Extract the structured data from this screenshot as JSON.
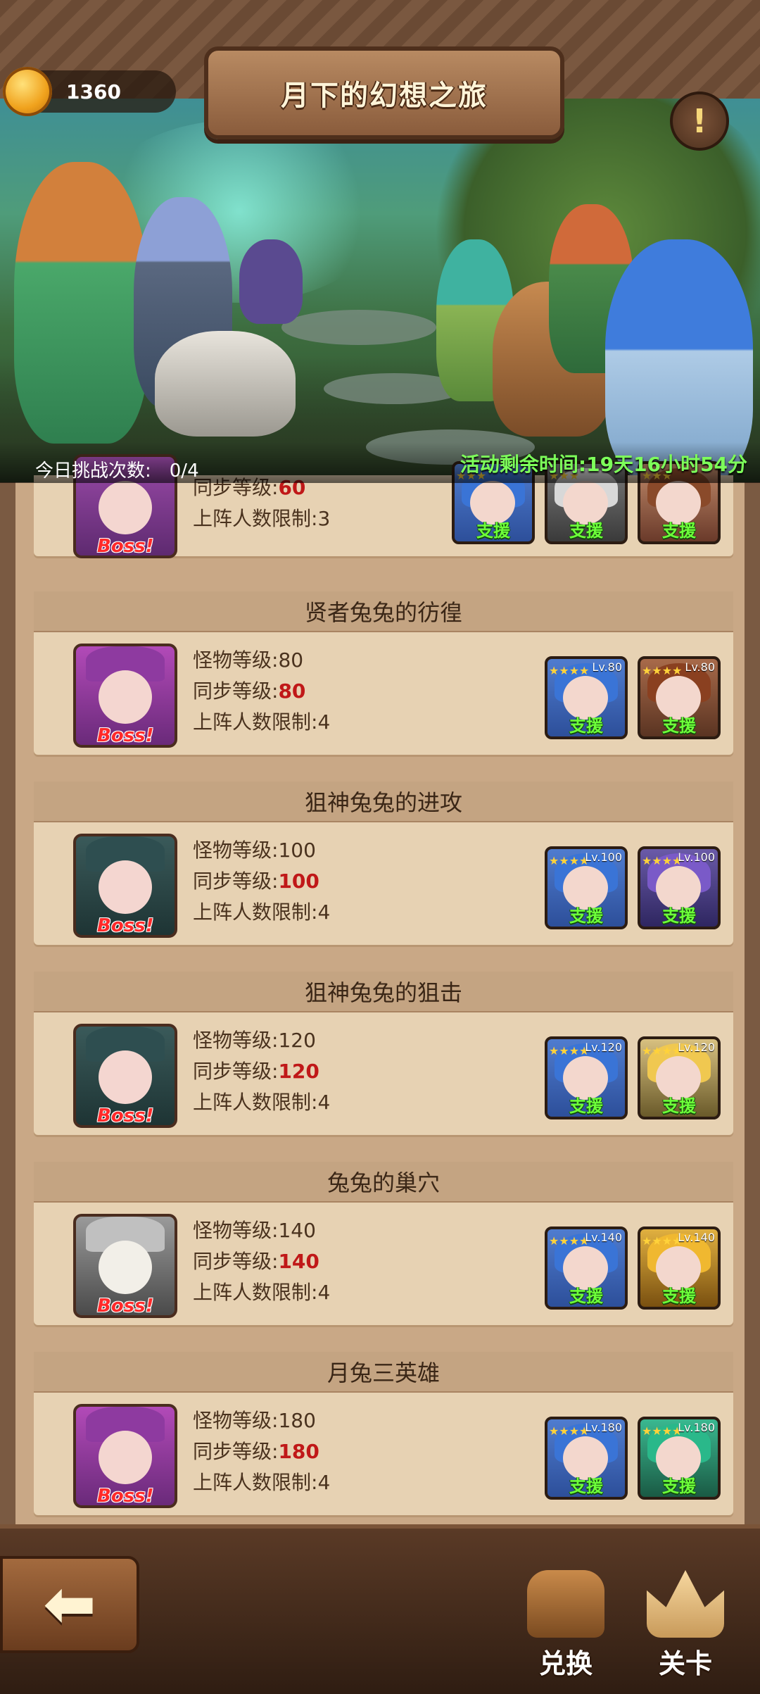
{
  "header": {
    "title": "月下的幻想之旅",
    "currency": "1360",
    "alert_icon": "!"
  },
  "banner": {
    "tries_label": "今日挑战次数:",
    "tries_value": "0/4",
    "remaining": "活动剩余时间:19天16小时54分"
  },
  "labels": {
    "monster_level": "怪物等级:",
    "sync_level": "同步等级:",
    "party_limit": "上阵人数限制:",
    "boss": "Boss!",
    "support": "支援"
  },
  "stages": [
    {
      "title": "",
      "monster_level": "",
      "sync_level": "60",
      "party_limit": "3",
      "allies": [
        {
          "lv": ""
        },
        {
          "lv": ""
        },
        {
          "lv": ""
        }
      ]
    },
    {
      "title": "贤者兔兔的彷徨",
      "monster_level": "80",
      "sync_level": "80",
      "party_limit": "4",
      "allies": [
        {
          "lv": "Lv.80"
        },
        {
          "lv": "Lv.80"
        }
      ]
    },
    {
      "title": "狙神兔兔的进攻",
      "monster_level": "100",
      "sync_level": "100",
      "party_limit": "4",
      "allies": [
        {
          "lv": "Lv.100"
        },
        {
          "lv": "Lv.100"
        }
      ]
    },
    {
      "title": "狙神兔兔的狙击",
      "monster_level": "120",
      "sync_level": "120",
      "party_limit": "4",
      "allies": [
        {
          "lv": "Lv.120"
        },
        {
          "lv": "Lv.120"
        }
      ]
    },
    {
      "title": "兔兔的巢穴",
      "monster_level": "140",
      "sync_level": "140",
      "party_limit": "4",
      "allies": [
        {
          "lv": "Lv.140"
        },
        {
          "lv": "Lv.140"
        }
      ]
    },
    {
      "title": "月兔三英雄",
      "monster_level": "180",
      "sync_level": "180",
      "party_limit": "4",
      "allies": [
        {
          "lv": "Lv.180"
        },
        {
          "lv": "Lv.180"
        }
      ]
    }
  ],
  "footer": {
    "back_icon": "back-arrow-icon",
    "exchange_label": "兑换",
    "stage_label": "关卡"
  },
  "colors": {
    "accent_green": "#7dff5a",
    "sync_red": "#c01818",
    "card_bg": "#e7d2b3"
  }
}
